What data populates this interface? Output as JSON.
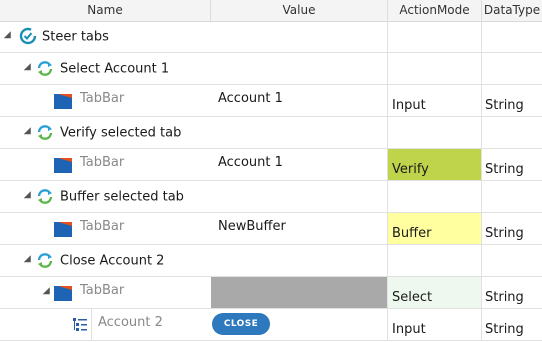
{
  "header": {
    "name": "Name",
    "value": "Value",
    "action_mode": "ActionMode",
    "data_type": "DataType"
  },
  "rows": [
    {
      "name": "Steer tabs",
      "value": "",
      "action_mode": "",
      "data_type": ""
    },
    {
      "name": "Select Account 1",
      "value": "",
      "action_mode": "",
      "data_type": ""
    },
    {
      "name": "TabBar",
      "value": "Account 1",
      "action_mode": "Input",
      "data_type": "String"
    },
    {
      "name": "Verify selected tab",
      "value": "",
      "action_mode": "",
      "data_type": ""
    },
    {
      "name": "TabBar",
      "value": "Account 1",
      "action_mode": "Verify",
      "data_type": "String"
    },
    {
      "name": "Buffer selected tab",
      "value": "",
      "action_mode": "",
      "data_type": ""
    },
    {
      "name": "TabBar",
      "value": "NewBuffer",
      "action_mode": "Buffer",
      "data_type": "String"
    },
    {
      "name": "Close Account 2",
      "value": "",
      "action_mode": "",
      "data_type": ""
    },
    {
      "name": "TabBar",
      "value": "",
      "action_mode": "Select",
      "data_type": "String"
    },
    {
      "name": "Account 2",
      "value": "CLOSE",
      "action_mode": "Input",
      "data_type": "String"
    }
  ],
  "colors": {
    "verify": "#bfd44a",
    "buffer": "#ffff9f",
    "select": "#eef8ee",
    "value_disabled": "#a9a9a9",
    "close_button": "#2e78bd"
  },
  "icons": {
    "testcase": "testcase-icon",
    "teststep": "teststep-refresh-icon",
    "module": "module-folder-icon",
    "tree_item": "tree-item-icon"
  }
}
